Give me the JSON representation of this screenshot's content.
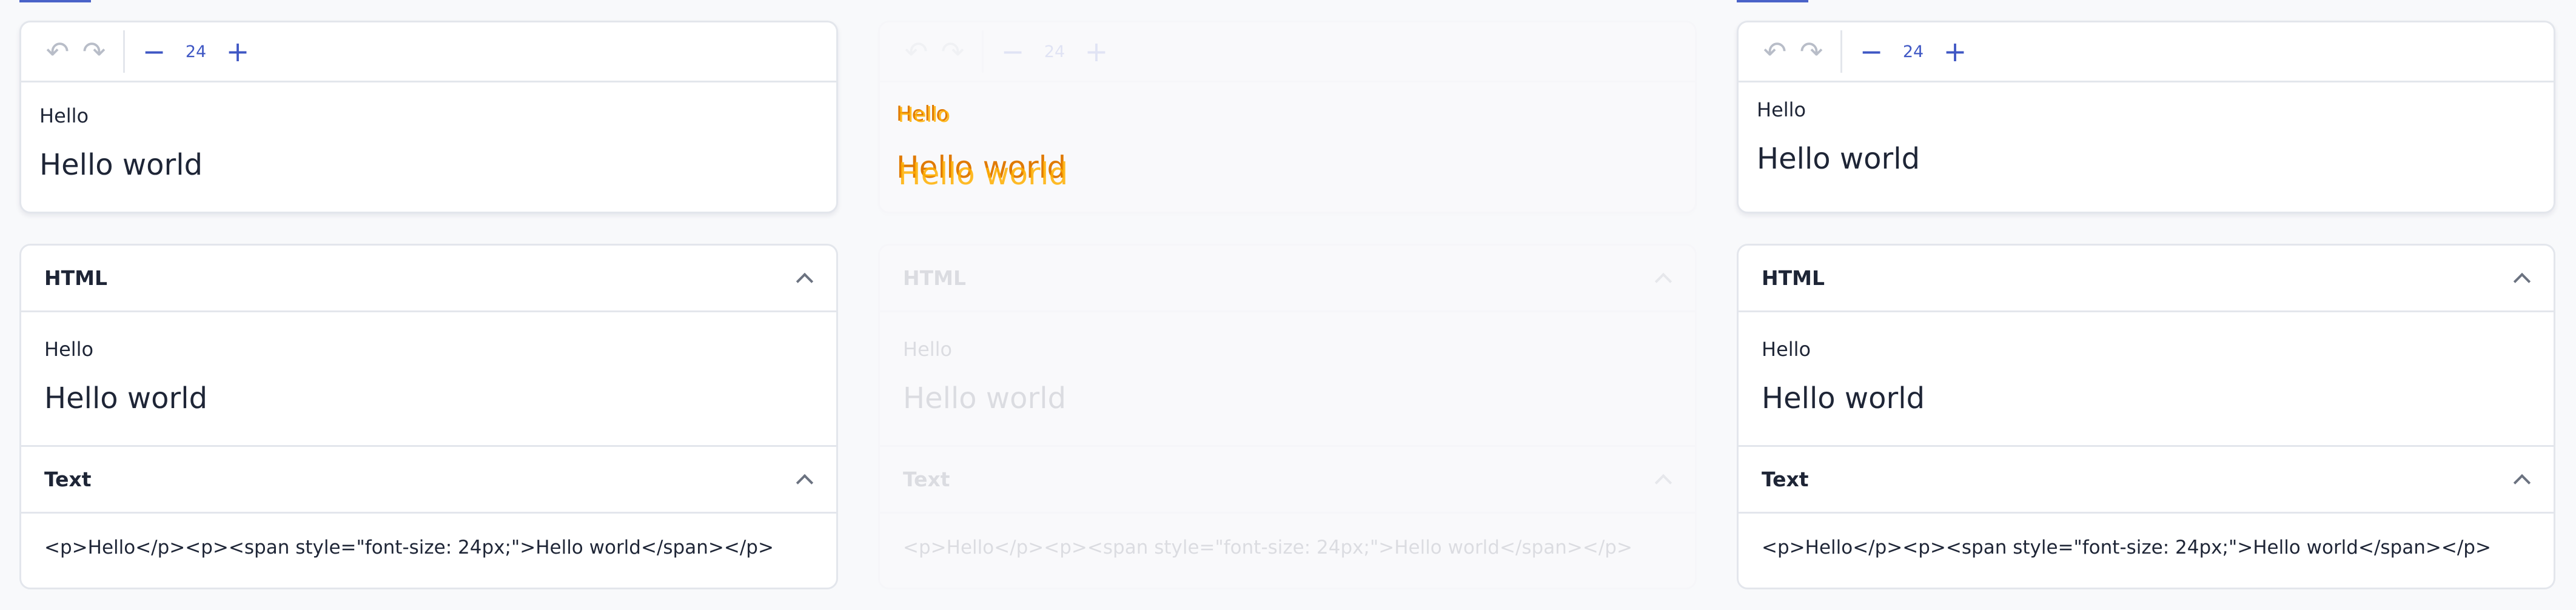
{
  "editor": {
    "font_size": "24",
    "paragraph_small": "Hello",
    "paragraph_big": "Hello world"
  },
  "html_section": {
    "title": "HTML",
    "paragraph_small": "Hello",
    "paragraph_big": "Hello world"
  },
  "text_section": {
    "title": "Text",
    "source": "<p>Hello</p><p><span style=\"font-size: 24px;\">Hello world</span></p>"
  },
  "diff_overlay": {
    "small": "Hello",
    "big": "Hello world"
  },
  "colors": {
    "accent": "#3f57c4",
    "diff_primary": "#e07a00",
    "diff_secondary": "#ffb000"
  },
  "icons": {
    "undo": "undo-icon",
    "redo": "redo-icon",
    "decrease": "minus-icon",
    "increase": "plus-icon",
    "collapse": "chevron-up-icon"
  }
}
